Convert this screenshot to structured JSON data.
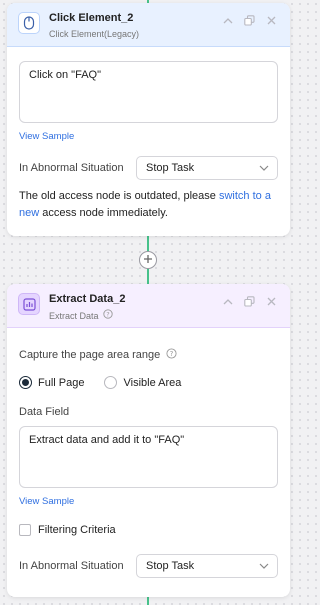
{
  "nodes": [
    {
      "title": "Click Element_2",
      "subtitle": "Click Element(Legacy)",
      "input_value": "Click on \"FAQ\"",
      "view_sample": "View Sample",
      "abnormal_label": "In Abnormal Situation",
      "abnormal_value": "Stop Task",
      "warning_pre": "The old access node is outdated, please ",
      "warning_link": "switch to a new",
      "warning_post": " access node immediately."
    },
    {
      "title": "Extract Data_2",
      "subtitle": "Extract Data",
      "capture_label": "Capture the page area range",
      "radio_full": "Full Page",
      "radio_visible": "Visible Area",
      "data_field_label": "Data Field",
      "data_field_value": "Extract data and add it to \"FAQ\"",
      "view_sample": "View Sample",
      "filter_label": "Filtering Criteria",
      "abnormal_label": "In Abnormal Situation",
      "abnormal_value": "Stop Task"
    }
  ],
  "colors": {
    "accent_blue": "#2f6fe0",
    "connector_green": "#47c28b"
  },
  "icons": [
    "mouse-icon",
    "chevron-up-icon",
    "duplicate-icon",
    "close-icon",
    "add-icon",
    "extract-data-icon",
    "help-icon",
    "chevron-down-icon"
  ]
}
